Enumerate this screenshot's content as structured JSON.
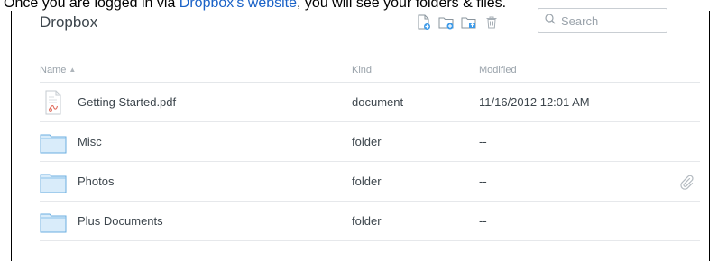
{
  "caption": {
    "before": "Once you are logged in via ",
    "link": "Dropbox's website",
    "after": ", you will see your folders & files."
  },
  "app": {
    "title": "Dropbox"
  },
  "toolbar": {
    "icons": [
      "new-file-icon",
      "new-folder-icon",
      "upload-folder-icon",
      "trash-icon"
    ]
  },
  "search": {
    "placeholder": "Search",
    "value": ""
  },
  "columns": {
    "name": "Name",
    "sort_indicator": "▲",
    "kind": "Kind",
    "modified": "Modified"
  },
  "files": [
    {
      "name": "Getting Started.pdf",
      "kind": "document",
      "modified": "11/16/2012 12:01 AM",
      "icon": "pdf-file-icon"
    },
    {
      "name": "Misc",
      "kind": "folder",
      "modified": "--",
      "icon": "folder-icon"
    },
    {
      "name": "Photos",
      "kind": "folder",
      "modified": "--",
      "icon": "folder-icon",
      "shared_link": "paperclip-icon"
    },
    {
      "name": "Plus Documents",
      "kind": "folder",
      "modified": "--",
      "icon": "folder-icon"
    }
  ],
  "colors": {
    "link": "#1a62c7",
    "accent": "#3d9ae8",
    "text": "#3d464d",
    "muted": "#9aa3ab"
  }
}
